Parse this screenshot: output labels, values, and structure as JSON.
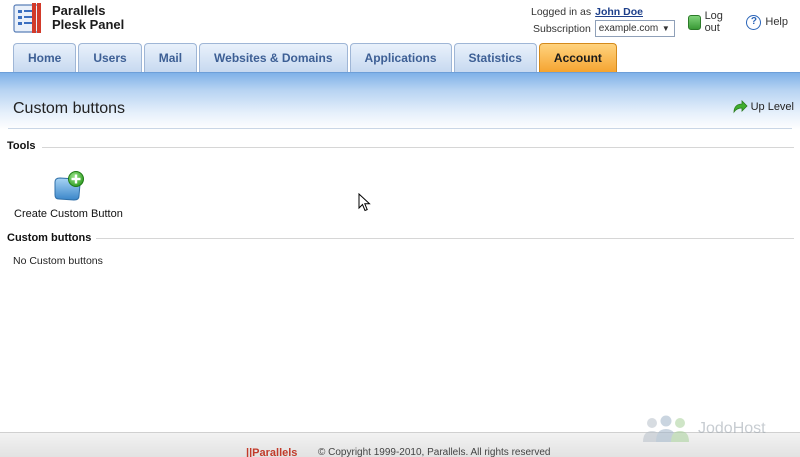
{
  "brand": {
    "line1": "Parallels",
    "line2": "Plesk Panel",
    "icon": "plesk-logo-icon"
  },
  "user": {
    "logged_in_label": "Logged in as",
    "username": "John Doe",
    "subscription_label": "Subscription",
    "subscription_value": "example.com"
  },
  "toplinks": {
    "logout": "Log out",
    "help": "Help"
  },
  "tabs": [
    {
      "label": "Home"
    },
    {
      "label": "Users"
    },
    {
      "label": "Mail"
    },
    {
      "label": "Websites & Domains"
    },
    {
      "label": "Applications"
    },
    {
      "label": "Statistics"
    },
    {
      "label": "Account"
    }
  ],
  "active_tab": "Account",
  "page": {
    "title": "Custom buttons",
    "up_level": "Up Level"
  },
  "sections": {
    "tools": {
      "heading": "Tools",
      "items": [
        {
          "label": "Create Custom Button",
          "icon": "add-button-icon"
        }
      ]
    },
    "custom_buttons": {
      "heading": "Custom buttons",
      "empty": "No Custom buttons"
    }
  },
  "footer": {
    "brand": "||Parallels",
    "copyright": "© Copyright 1999-2010, Parallels. All rights reserved"
  },
  "watermark": {
    "text": "JodoHost"
  },
  "colors": {
    "tab_active": "#f5a431",
    "tab_inactive": "#c7d9f0",
    "tab_text": "#3d5f95",
    "title_band": "#7fb1e8"
  }
}
